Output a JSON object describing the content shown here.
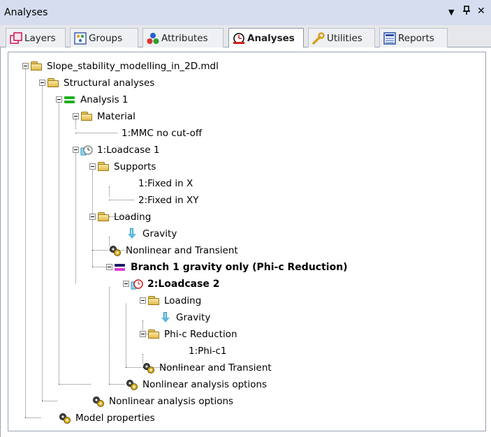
{
  "window": {
    "title": "Analyses",
    "controls": {
      "dropdown": "▼",
      "pin": "ᵾ",
      "close": "✕"
    }
  },
  "tabs": [
    {
      "label": "Layers",
      "icon": "layers-icon",
      "active": false
    },
    {
      "label": "Groups",
      "icon": "groups-icon",
      "active": false
    },
    {
      "label": "Attributes",
      "icon": "attributes-icon",
      "active": false
    },
    {
      "label": "Analyses",
      "icon": "analyses-icon",
      "active": true
    },
    {
      "label": "Utilities",
      "icon": "utilities-icon",
      "active": false
    },
    {
      "label": "Reports",
      "icon": "reports-icon",
      "active": false
    }
  ],
  "tree": {
    "root": "Slope_stability_modelling_in_2D.mdl",
    "structural_analyses": "Structural analyses",
    "analysis1": "Analysis 1",
    "material": "Material",
    "mmc": "1:MMC no cut-off",
    "loadcase1": "1:Loadcase 1",
    "supports": "Supports",
    "fixed_x": "1:Fixed in X",
    "fixed_xy": "2:Fixed in XY",
    "loading1": "Loading",
    "gravity1": "Gravity",
    "nonlinear1": "Nonlinear and Transient",
    "branch1": "Branch 1 gravity only (Phi-c Reduction)",
    "loadcase2": "2:Loadcase 2",
    "loading2": "Loading",
    "gravity2": "Gravity",
    "phic": "Phi-c Reduction",
    "phic1": "1:Phi-c1",
    "nonlinear2": "Nonlinear and Transient",
    "nl_options_inner": "Nonlinear analysis options",
    "nl_options_outer": "Nonlinear analysis options",
    "model_props": "Model properties"
  },
  "colors": {
    "title_bar": "#d5ddef",
    "tab_strip": "#e6e7ea",
    "folder": "#f2d67a",
    "analysis_green": "#1fb01f",
    "branch_magenta": "#e23ad8",
    "gravity_arrow": "#5fb8df"
  }
}
